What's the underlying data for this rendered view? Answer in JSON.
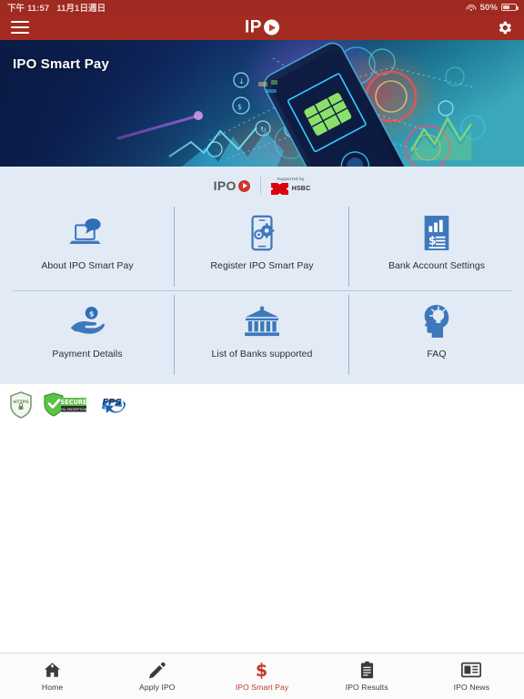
{
  "status_bar": {
    "time": "下午 11:57",
    "date": "11月1日週日",
    "wifi_icon": "wifi-icon",
    "battery_percent": "50%",
    "battery_icon": "battery-icon"
  },
  "app_bar": {
    "menu_icon": "hamburger-menu-icon",
    "brand_text": "IP",
    "brand_play_icon": "play-circle-icon",
    "settings_icon": "gear-icon"
  },
  "hero": {
    "title": "IPO Smart Pay"
  },
  "panel": {
    "ipo_logo_text": "IPO",
    "supported_by": "Supported by",
    "partner_name": "HSBC",
    "partner_logo_icon": "hsbc-hexagon-icon",
    "menu": [
      {
        "label": "About IPO Smart Pay",
        "icon": "laptop-chat-icon"
      },
      {
        "label": "Register IPO Smart Pay",
        "icon": "phone-gears-icon"
      },
      {
        "label": "Bank Account Settings",
        "icon": "document-chart-dollar-icon"
      },
      {
        "label": "Payment Details",
        "icon": "hand-coin-icon"
      },
      {
        "label": "List of Banks supported",
        "icon": "bank-building-icon"
      },
      {
        "label": "FAQ",
        "icon": "head-lightbulb-icon"
      }
    ]
  },
  "badges": [
    {
      "name": "https-shield-badge",
      "label": "HTTPS"
    },
    {
      "name": "secure-ssl-badge",
      "label": "SECURE"
    },
    {
      "name": "fps-badge",
      "label": "FPS"
    }
  ],
  "tab_bar": {
    "items": [
      {
        "label": "Home",
        "icon": "home-icon",
        "active": false
      },
      {
        "label": "Apply IPO",
        "icon": "pencil-icon",
        "active": false
      },
      {
        "label": "IPO Smart Pay",
        "icon": "dollar-sign-icon",
        "active": true
      },
      {
        "label": "IPO Results",
        "icon": "clipboard-icon",
        "active": false
      },
      {
        "label": "IPO News",
        "icon": "newspaper-icon",
        "active": false
      }
    ]
  },
  "colors": {
    "header_red": "#a32b22",
    "status_red": "#9e2a22",
    "panel_blue": "#e2ebf5",
    "icon_blue": "#3e78bc",
    "active_tab_red": "#c0392b",
    "hsbc_red": "#db0011"
  }
}
